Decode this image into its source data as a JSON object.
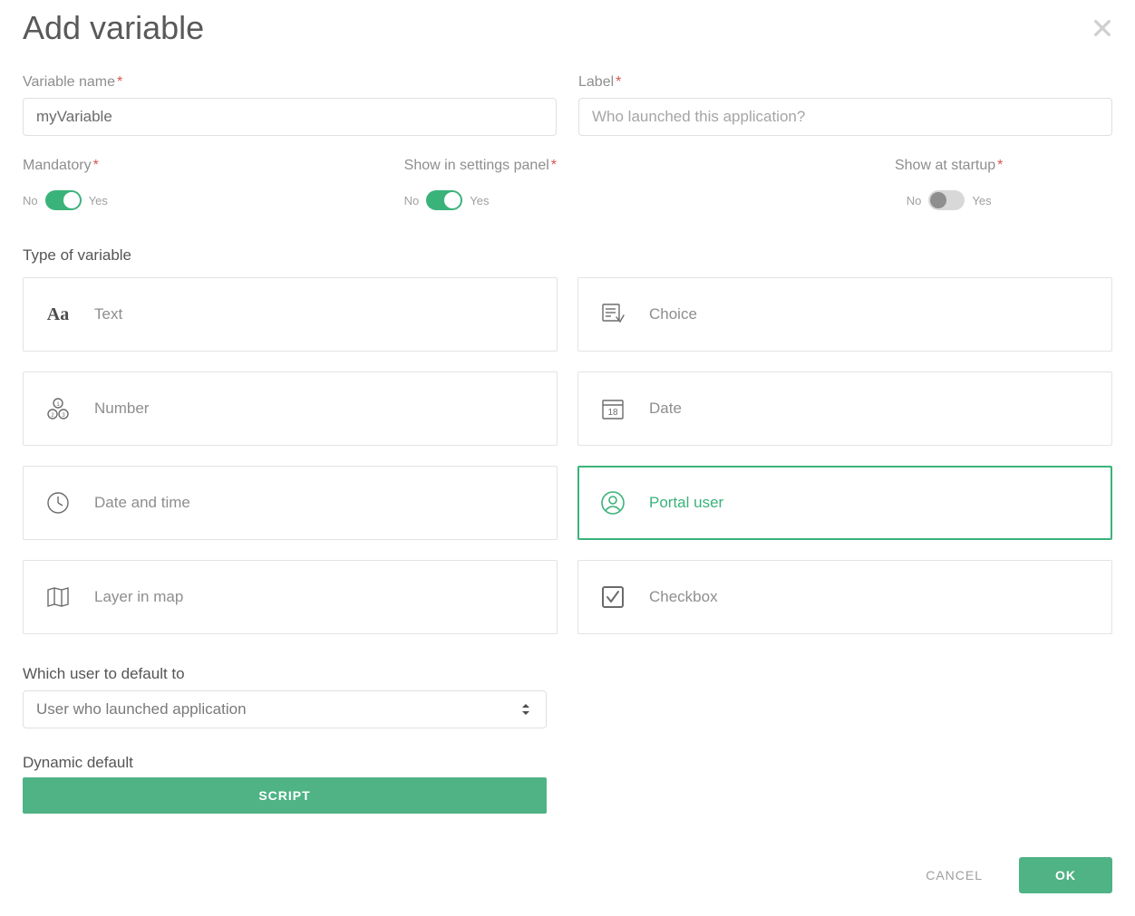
{
  "dialog": {
    "title": "Add variable"
  },
  "fields": {
    "variable_name": {
      "label": "Variable name",
      "value": "myVariable"
    },
    "label": {
      "label": "Label",
      "placeholder": "Who launched this application?"
    },
    "mandatory": {
      "label": "Mandatory",
      "no": "No",
      "yes": "Yes",
      "on": true
    },
    "show_in_settings": {
      "label": "Show in settings panel",
      "no": "No",
      "yes": "Yes",
      "on": true
    },
    "show_at_startup": {
      "label": "Show at startup",
      "no": "No",
      "yes": "Yes",
      "on": false
    }
  },
  "type_section": {
    "label": "Type of variable",
    "types": {
      "text": "Text",
      "choice": "Choice",
      "number": "Number",
      "date": "Date",
      "datetime": "Date and time",
      "portal_user": "Portal user",
      "layer": "Layer in map",
      "checkbox": "Checkbox"
    },
    "selected": "portal_user"
  },
  "default_user": {
    "label": "Which user to default to",
    "selected": "User who launched application"
  },
  "dynamic_default": {
    "label": "Dynamic default",
    "button": "SCRIPT"
  },
  "footer": {
    "cancel": "CANCEL",
    "ok": "OK"
  }
}
